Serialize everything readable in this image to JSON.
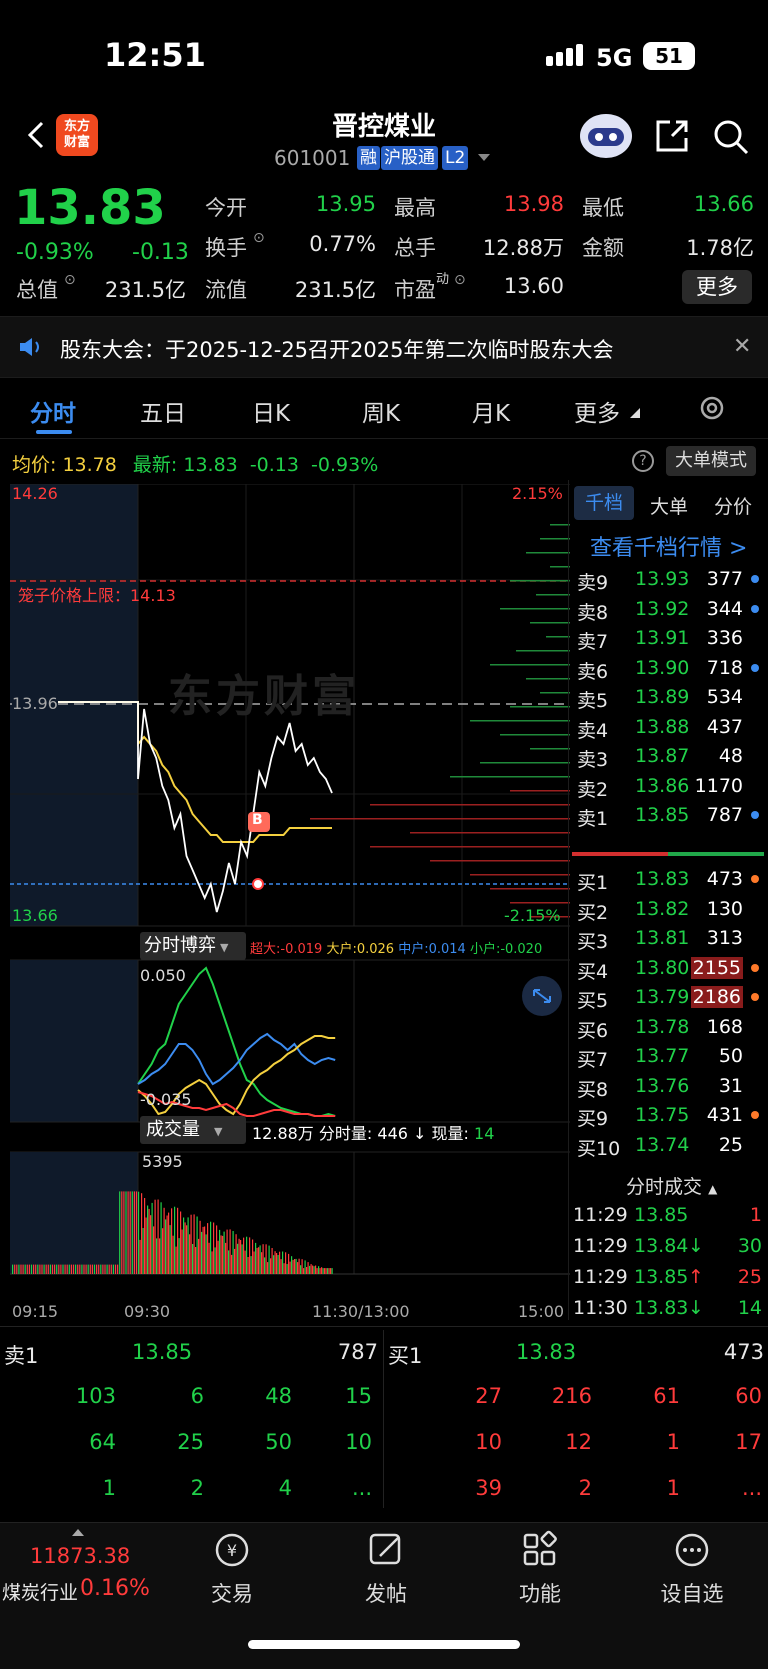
{
  "status": {
    "time": "12:51",
    "network": "5G",
    "battery": "51"
  },
  "header": {
    "name": "晋控煤业",
    "code": "601001",
    "tags": [
      "融",
      "沪股通",
      "L2"
    ],
    "logo": "东方\n财富"
  },
  "quote": {
    "price": "13.83",
    "pct": "-0.93%",
    "chg": "-0.13",
    "open_label": "今开",
    "open": "13.95",
    "high_label": "最高",
    "high": "13.98",
    "low_label": "最低",
    "low": "13.66",
    "turnover_label": "换手",
    "turnover": "0.77%",
    "volume_label": "总手",
    "volume": "12.88万",
    "amount_label": "金额",
    "amount": "1.78亿",
    "mcap_label": "总值",
    "mcap": "231.5亿",
    "float_label": "流值",
    "float": "231.5亿",
    "pe_label": "市盈",
    "pe_sup": "动",
    "pe": "13.60",
    "more": "更多"
  },
  "notice": {
    "text": "股东大会：于2025-12-25召开2025年第二次临时股东大会"
  },
  "tabs": [
    "分时",
    "五日",
    "日K",
    "周K",
    "月K",
    "更多"
  ],
  "info": {
    "avg_label": "均价:",
    "avg": "13.78",
    "last_label": "最新:",
    "last": "13.83",
    "chg": "-0.13",
    "pct": "-0.93%",
    "big_mode": "大单模式"
  },
  "chart": {
    "y_top": "14.26",
    "y_bottom": "13.66",
    "pct_top": "2.15%",
    "pct_bottom": "-2.15%",
    "cage_label": "笼子价格上限：14.13",
    "prev_close": "13.96",
    "watermark": "东方财富",
    "buy_marker": "B",
    "game_label": "分时博弈",
    "game_top": "0.050",
    "game_bottom": "-0.035",
    "game_legend": [
      {
        "text": "超大:-0.019",
        "color": "#ff3b3b"
      },
      {
        "text": "大户:0.026",
        "color": "#f4d03f"
      },
      {
        "text": "中户:0.014",
        "color": "#3c8cf0"
      },
      {
        "text": "小户:-0.020",
        "color": "#21d14a"
      }
    ],
    "vol_label": "成交量",
    "vol_total": "12.88万",
    "vol_period_label": "分时量:",
    "vol_period": "446",
    "vol_now_label": "现量:",
    "vol_now": "14",
    "vol_top": "5395",
    "time_ticks": [
      "09:15",
      "09:30",
      "11:30/13:00",
      "15:00"
    ]
  },
  "chart_data": {
    "type": "line",
    "title": "",
    "ylim": [
      13.66,
      14.26
    ],
    "prev_close": 13.96,
    "series": [
      {
        "values": [
          13.96,
          13.96,
          13.96,
          13.96,
          13.85,
          13.95,
          13.9,
          13.88,
          13.84,
          13.82,
          13.78,
          13.8,
          13.74,
          13.72,
          13.7,
          13.68,
          13.7,
          13.66,
          13.69,
          13.73,
          13.7,
          13.76,
          13.74,
          13.8,
          13.86,
          13.84,
          13.88,
          13.91,
          13.9,
          13.93,
          13.89,
          13.9,
          13.87,
          13.88,
          13.86,
          13.85,
          13.83
        ]
      },
      {
        "values": [
          13.96,
          13.96,
          13.96,
          13.96,
          13.9,
          13.91,
          13.9,
          13.89,
          13.87,
          13.86,
          13.84,
          13.83,
          13.82,
          13.8,
          13.79,
          13.78,
          13.77,
          13.77,
          13.76,
          13.76,
          13.76,
          13.76,
          13.76,
          13.76,
          13.77,
          13.77,
          13.77,
          13.77,
          13.77,
          13.78,
          13.78,
          13.78,
          13.78,
          13.78,
          13.78,
          13.78,
          13.78
        ]
      }
    ]
  },
  "right_tabs": [
    "千档",
    "大单",
    "分价"
  ],
  "qd_link": "查看千档行情 >",
  "asks": [
    {
      "label": "卖9",
      "price": "13.93",
      "vol": "377",
      "dot": "#3c8cf0",
      "color": "g"
    },
    {
      "label": "卖8",
      "price": "13.92",
      "vol": "344",
      "dot": "#3c8cf0",
      "color": "g"
    },
    {
      "label": "卖7",
      "price": "13.91",
      "vol": "336",
      "dot": "",
      "color": "g"
    },
    {
      "label": "卖6",
      "price": "13.90",
      "vol": "718",
      "dot": "#3c8cf0",
      "color": "g"
    },
    {
      "label": "卖5",
      "price": "13.89",
      "vol": "534",
      "dot": "",
      "color": "g"
    },
    {
      "label": "卖4",
      "price": "13.88",
      "vol": "437",
      "dot": "",
      "color": "g"
    },
    {
      "label": "卖3",
      "price": "13.87",
      "vol": "48",
      "dot": "",
      "color": "g"
    },
    {
      "label": "卖2",
      "price": "13.86",
      "vol": "1170",
      "dot": "",
      "color": "g"
    },
    {
      "label": "卖1",
      "price": "13.85",
      "vol": "787",
      "dot": "#3c8cf0",
      "color": "g"
    }
  ],
  "bids": [
    {
      "label": "买1",
      "price": "13.83",
      "vol": "473",
      "dot": "#ff7a2a",
      "color": "g"
    },
    {
      "label": "买2",
      "price": "13.82",
      "vol": "130",
      "dot": "",
      "color": "g"
    },
    {
      "label": "买3",
      "price": "13.81",
      "vol": "313",
      "dot": "",
      "color": "g"
    },
    {
      "label": "买4",
      "price": "13.80",
      "vol": "2155",
      "dot": "#ff7a2a",
      "color": "g"
    },
    {
      "label": "买5",
      "price": "13.79",
      "vol": "2186",
      "dot": "#ff7a2a",
      "color": "g"
    },
    {
      "label": "买6",
      "price": "13.78",
      "vol": "168",
      "dot": "",
      "color": "g"
    },
    {
      "label": "买7",
      "price": "13.77",
      "vol": "50",
      "dot": "",
      "color": "g"
    },
    {
      "label": "买8",
      "price": "13.76",
      "vol": "31",
      "dot": "",
      "color": "g"
    },
    {
      "label": "买9",
      "price": "13.75",
      "vol": "431",
      "dot": "#ff7a2a",
      "color": "g"
    },
    {
      "label": "买10",
      "price": "13.74",
      "vol": "25",
      "dot": "",
      "color": "g"
    }
  ],
  "ticks_title": "分时成交",
  "ticks": [
    {
      "time": "11:29",
      "price": "13.85",
      "arrow": "",
      "vol": "1",
      "vc": "r"
    },
    {
      "time": "11:29",
      "price": "13.84",
      "arrow": "↓",
      "vol": "30",
      "vc": "g"
    },
    {
      "time": "11:29",
      "price": "13.85",
      "arrow": "↑",
      "vol": "25",
      "vc": "r"
    },
    {
      "time": "11:30",
      "price": "13.83",
      "arrow": "↓",
      "vol": "14",
      "vc": "g"
    }
  ],
  "bottom_quote": {
    "ask_label": "卖1",
    "ask_price": "13.85",
    "ask_vol": "787",
    "bid_label": "买1",
    "bid_price": "13.83",
    "bid_vol": "473",
    "ask_queue": [
      [
        "103",
        "6",
        "48",
        "15"
      ],
      [
        "64",
        "25",
        "50",
        "10"
      ],
      [
        "1",
        "2",
        "4",
        "..."
      ]
    ],
    "bid_queue": [
      [
        "27",
        "216",
        "61",
        "60"
      ],
      [
        "10",
        "12",
        "1",
        "17"
      ],
      [
        "39",
        "2",
        "1",
        "..."
      ]
    ]
  },
  "nav": {
    "index_value": "11873.38",
    "index_name": "煤炭行业",
    "index_pct": "0.16%",
    "items": [
      "交易",
      "发帖",
      "功能",
      "设自选"
    ]
  }
}
